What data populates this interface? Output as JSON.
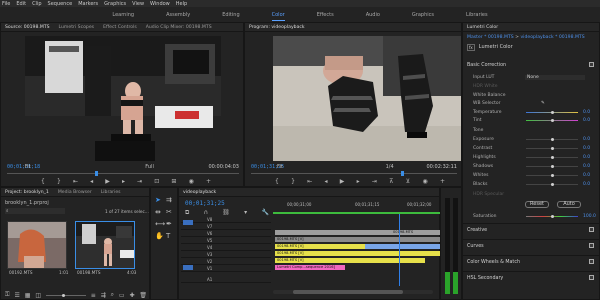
{
  "menu": [
    "File",
    "Edit",
    "Clip",
    "Sequence",
    "Markers",
    "Graphics",
    "View",
    "Window",
    "Help"
  ],
  "workspaces": [
    {
      "label": "Learning",
      "active": false
    },
    {
      "label": "Assembly",
      "active": false
    },
    {
      "label": "Editing",
      "active": false
    },
    {
      "label": "Color",
      "active": true
    },
    {
      "label": "Effects",
      "active": false
    },
    {
      "label": "Audio",
      "active": false
    },
    {
      "label": "Graphics",
      "active": false
    },
    {
      "label": "Libraries",
      "active": false
    }
  ],
  "source": {
    "tabs": [
      "Source: 00198.MTS",
      "Lumetri Scopes",
      "Effect Controls",
      "Audio Clip Mixer: 00198.MTS"
    ],
    "timecode_in": "00;01;31;18",
    "fit": "Fit",
    "full": "Full",
    "timecode_out": "00:00:04:03"
  },
  "program": {
    "title": "Program: videoplayback",
    "timecode_in": "00;01;31;25",
    "fit": "Fit",
    "page": "1/4",
    "timecode_out": "00:02:32:11"
  },
  "lumetri": {
    "title": "Lumetri Color",
    "master": "Master * 00198.MTS",
    "clip": "videoplayback * 00198.MTS",
    "fx_name": "Lumetri Color",
    "basic_correction": "Basic Correction",
    "input_lut_label": "Input LUT",
    "input_lut_value": "None",
    "hdr_white_label": "HDR White",
    "white_balance": "White Balance",
    "wb_selector": "WB Selector",
    "temperature_label": "Temperature",
    "temperature_value": "0.0",
    "tint_label": "Tint",
    "tint_value": "0.0",
    "tone": "Tone",
    "exposure_label": "Exposure",
    "exposure_value": "0.0",
    "contrast_label": "Contrast",
    "contrast_value": "0.0",
    "highlights_label": "Highlights",
    "highlights_value": "0.0",
    "shadows_label": "Shadows",
    "shadows_value": "0.0",
    "whites_label": "Whites",
    "whites_value": "0.0",
    "blacks_label": "Blacks",
    "blacks_value": "0.0",
    "hdr_specular": "HDR Specular",
    "reset_label": "Reset",
    "auto_label": "Auto",
    "saturation_label": "Saturation",
    "saturation_value": "100.0",
    "creative": "Creative",
    "curves": "Curves",
    "color_wheels": "Color Wheels & Match",
    "hsl": "HSL Secondary"
  },
  "project": {
    "tabs": [
      "Project: brooklyn_1",
      "Media Browser",
      "Libraries"
    ],
    "file": "brooklyn_1.prproj",
    "items_info": "1 of 27 items selec...",
    "clips": [
      {
        "name": "00192.MTS",
        "duration": "1:01"
      },
      {
        "name": "00198.MTS",
        "duration": "4:03"
      }
    ]
  },
  "timeline": {
    "title": "videoplayback",
    "timecode": "00;01;31;25",
    "ruler": [
      "00;00;31;00",
      "00;01;31;15",
      "00;01;32;00"
    ],
    "video_tracks": [
      "V8",
      "V7",
      "V6",
      "V5",
      "V4",
      "V3",
      "V2",
      "V1"
    ],
    "audio_tracks": [
      "A1"
    ],
    "clips": [
      {
        "label": "00198.MTS",
        "color": "#9e9e9e"
      },
      {
        "label": "00198.MTS [V]",
        "color": "#9e9e9e"
      },
      {
        "label": "00198.MTS [V]",
        "color": "#e6e04a"
      },
      {
        "label": "00198.MTS [V]",
        "color": "#e6e04a"
      },
      {
        "label": "00198.MTS [V]",
        "color": "#e6e04a"
      },
      {
        "label": "Lumetri Comp...sequence 2016]",
        "color": "#f067c0"
      }
    ]
  },
  "colors": {
    "accent": "#4d8fe8",
    "playhead": "#2f7fe8",
    "clip_yellow": "#e6e04a",
    "clip_pink": "#f067c0",
    "clip_blue": "#79a6e8"
  }
}
